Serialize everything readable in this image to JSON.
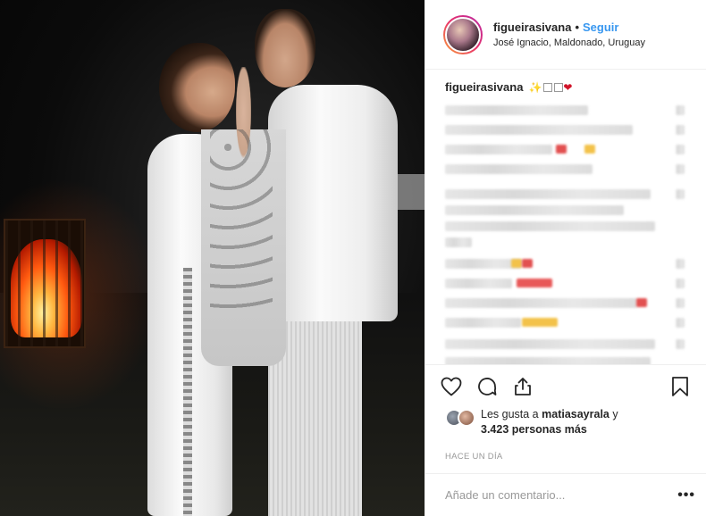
{
  "post": {
    "username": "figueirasivana",
    "separator": "•",
    "follow_label": "Seguir",
    "location": "José Ignacio, Maldonado, Uruguay"
  },
  "caption": {
    "username": "figueirasivana",
    "emoji_sparkle": "✨",
    "emoji_heart": "❤"
  },
  "icons": {
    "like": "heart-icon",
    "comment": "comment-bubble-icon",
    "share": "share-icon",
    "save": "bookmark-icon",
    "more": "more-options-icon"
  },
  "likes": {
    "prefix": "Les gusta a",
    "user": "matiasayrala",
    "joiner": "y",
    "count_text": "3.423 personas más"
  },
  "timestamp": "HACE UN DÍA",
  "comment_box": {
    "placeholder": "Añade un comentario...",
    "more_label": "•••"
  },
  "colors": {
    "accent": "#3897f0",
    "text": "#262626",
    "muted": "#999999",
    "border": "#efefef"
  }
}
